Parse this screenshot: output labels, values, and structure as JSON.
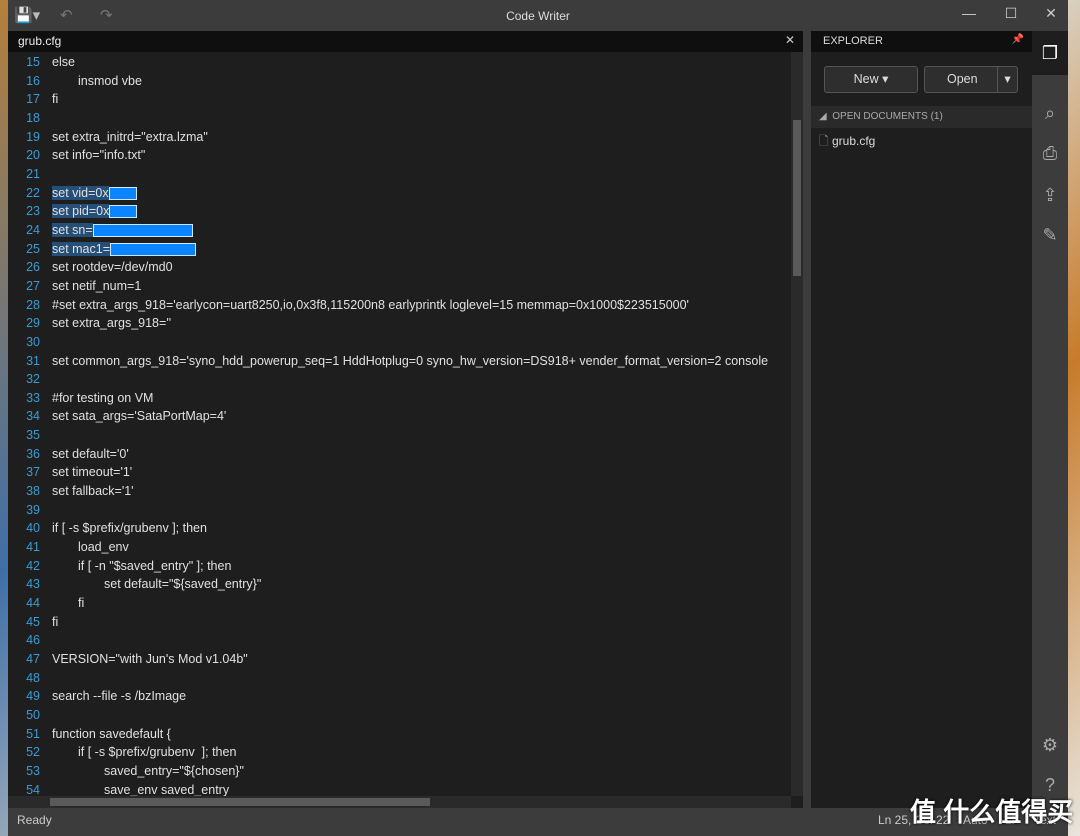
{
  "app": {
    "title": "Code Writer"
  },
  "toolbar": {
    "save_icon": "save-icon",
    "undo_icon": "undo-icon",
    "redo_icon": "redo-icon"
  },
  "window_controls": {
    "minimize": "—",
    "maximize": "☐",
    "close": "✕"
  },
  "editor": {
    "tab": "grub.cfg",
    "tab_close": "✕",
    "lines": [
      {
        "n": "15",
        "indent": 0,
        "text": "else"
      },
      {
        "n": "16",
        "indent": 1,
        "text": "insmod vbe"
      },
      {
        "n": "17",
        "indent": 0,
        "text": "fi"
      },
      {
        "n": "18",
        "indent": 0,
        "text": ""
      },
      {
        "n": "19",
        "indent": 0,
        "text": "set extra_initrd=\"extra.lzma\""
      },
      {
        "n": "20",
        "indent": 0,
        "text": "set info=\"info.txt\""
      },
      {
        "n": "21",
        "indent": 0,
        "text": ""
      },
      {
        "n": "22",
        "indent": 0,
        "text": "set vid=0x",
        "selected": true,
        "redact": 28
      },
      {
        "n": "23",
        "indent": 0,
        "text": "set pid=0x",
        "selected": true,
        "redact": 28
      },
      {
        "n": "24",
        "indent": 0,
        "text": "set sn=",
        "selected": true,
        "redact": 100
      },
      {
        "n": "25",
        "indent": 0,
        "text": "set mac1=",
        "selected": true,
        "redact": 86
      },
      {
        "n": "26",
        "indent": 0,
        "text": "set rootdev=/dev/md0"
      },
      {
        "n": "27",
        "indent": 0,
        "text": "set netif_num=1"
      },
      {
        "n": "28",
        "indent": 0,
        "text": "#set extra_args_918='earlycon=uart8250,io,0x3f8,115200n8 earlyprintk loglevel=15 memmap=0x1000$223515000'"
      },
      {
        "n": "29",
        "indent": 0,
        "text": "set extra_args_918=''"
      },
      {
        "n": "30",
        "indent": 0,
        "text": ""
      },
      {
        "n": "31",
        "indent": 0,
        "text": "set common_args_918='syno_hdd_powerup_seq=1 HddHotplug=0 syno_hw_version=DS918+ vender_format_version=2 console"
      },
      {
        "n": "32",
        "indent": 0,
        "text": ""
      },
      {
        "n": "33",
        "indent": 0,
        "text": "#for testing on VM"
      },
      {
        "n": "34",
        "indent": 0,
        "text": "set sata_args='SataPortMap=4'"
      },
      {
        "n": "35",
        "indent": 0,
        "text": ""
      },
      {
        "n": "36",
        "indent": 0,
        "text": "set default='0'"
      },
      {
        "n": "37",
        "indent": 0,
        "text": "set timeout='1'"
      },
      {
        "n": "38",
        "indent": 0,
        "text": "set fallback='1'"
      },
      {
        "n": "39",
        "indent": 0,
        "text": ""
      },
      {
        "n": "40",
        "indent": 0,
        "text": "if [ -s $prefix/grubenv ]; then"
      },
      {
        "n": "41",
        "indent": 1,
        "text": "load_env"
      },
      {
        "n": "42",
        "indent": 1,
        "text": "if [ -n \"$saved_entry\" ]; then"
      },
      {
        "n": "43",
        "indent": 2,
        "text": "set default=\"${saved_entry}\""
      },
      {
        "n": "44",
        "indent": 1,
        "text": "fi"
      },
      {
        "n": "45",
        "indent": 0,
        "text": "fi"
      },
      {
        "n": "46",
        "indent": 0,
        "text": ""
      },
      {
        "n": "47",
        "indent": 0,
        "text": "VERSION=\"with Jun's Mod v1.04b\""
      },
      {
        "n": "48",
        "indent": 0,
        "text": ""
      },
      {
        "n": "49",
        "indent": 0,
        "text": "search --file -s /bzImage"
      },
      {
        "n": "50",
        "indent": 0,
        "text": ""
      },
      {
        "n": "51",
        "indent": 0,
        "text": "function savedefault {"
      },
      {
        "n": "52",
        "indent": 1,
        "text": "if [ -s $prefix/grubenv  ]; then"
      },
      {
        "n": "53",
        "indent": 2,
        "text": "saved_entry=\"${chosen}\""
      },
      {
        "n": "54",
        "indent": 2,
        "text": "save_env saved_entry"
      }
    ]
  },
  "explorer": {
    "title": "EXPLORER",
    "new_label": "New ▾",
    "open_label": "Open",
    "open_dropdown": "▾",
    "section": "OPEN DOCUMENTS (1)",
    "documents": [
      "grub.cfg"
    ]
  },
  "rail": [
    "documents-icon",
    "search-icon",
    "print-icon",
    "share-icon",
    "edit-icon",
    "settings-icon",
    "help-icon"
  ],
  "status": {
    "ready": "Ready",
    "position": "Ln 25, Col 22",
    "encoding": "Auto",
    "line_ending": "LF",
    "language": "Text"
  },
  "watermark": "值 什么值得买",
  "colors": {
    "line_numbers": "#3a9bd5",
    "selection": "#264f78",
    "redaction": "#0a84ff"
  }
}
